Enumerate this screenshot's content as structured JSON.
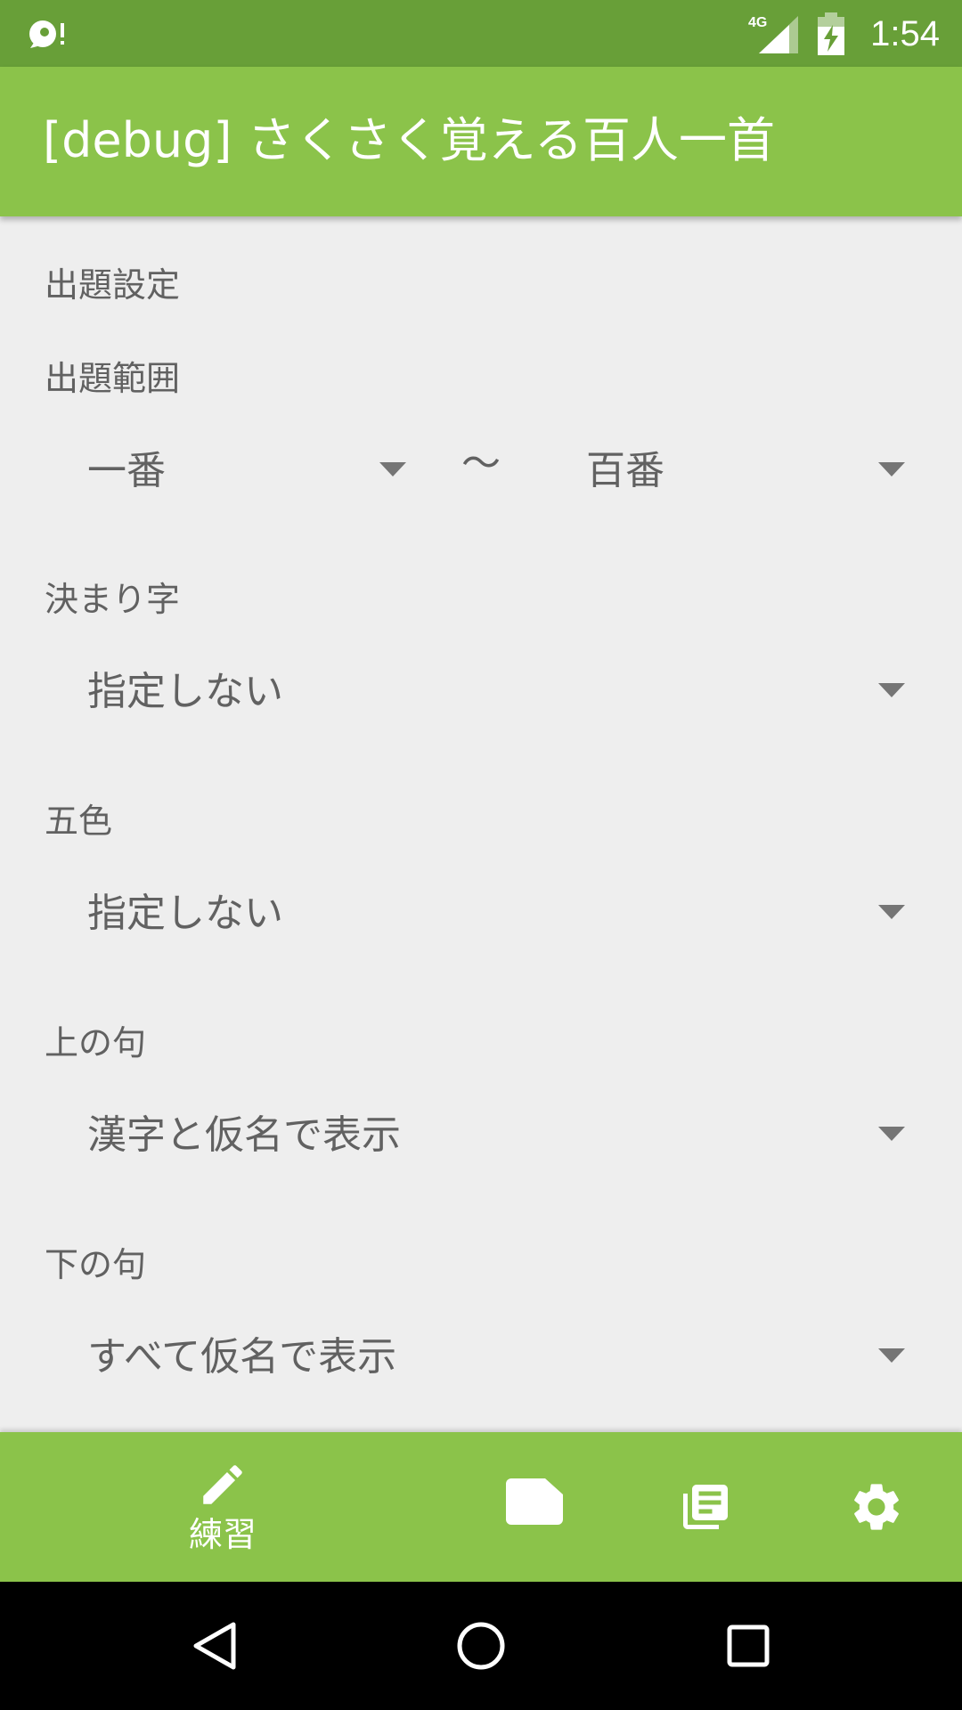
{
  "status_bar": {
    "network_label": "4G",
    "time": "1:54",
    "icons": [
      "notification-alert-icon",
      "cell-signal-icon",
      "battery-charging-icon"
    ]
  },
  "app_bar": {
    "title": "[debug] さくさく覚える百人一首"
  },
  "settings": {
    "section_title": "出題設定",
    "range": {
      "label": "出題範囲",
      "from_value": "一番",
      "separator": "～",
      "to_value": "百番"
    },
    "kimariji": {
      "label": "決まり字",
      "value": "指定しない"
    },
    "goshiki": {
      "label": "五色",
      "value": "指定しない"
    },
    "kami_no_ku": {
      "label": "上の句",
      "value": "漢字と仮名で表示"
    },
    "shimo_no_ku": {
      "label": "下の句",
      "value": "すべて仮名で表示"
    }
  },
  "bottom_nav": {
    "items": [
      {
        "label": "練習",
        "icon": "pencil-icon",
        "selected": true
      },
      {
        "label": "",
        "icon": "card-icon",
        "selected": false
      },
      {
        "label": "",
        "icon": "library-icon",
        "selected": false
      },
      {
        "label": "",
        "icon": "gear-icon",
        "selected": false
      }
    ]
  },
  "colors": {
    "status_bar": "#689f38",
    "primary": "#8bc34a",
    "background": "#eeeeee",
    "text": "#616161"
  }
}
